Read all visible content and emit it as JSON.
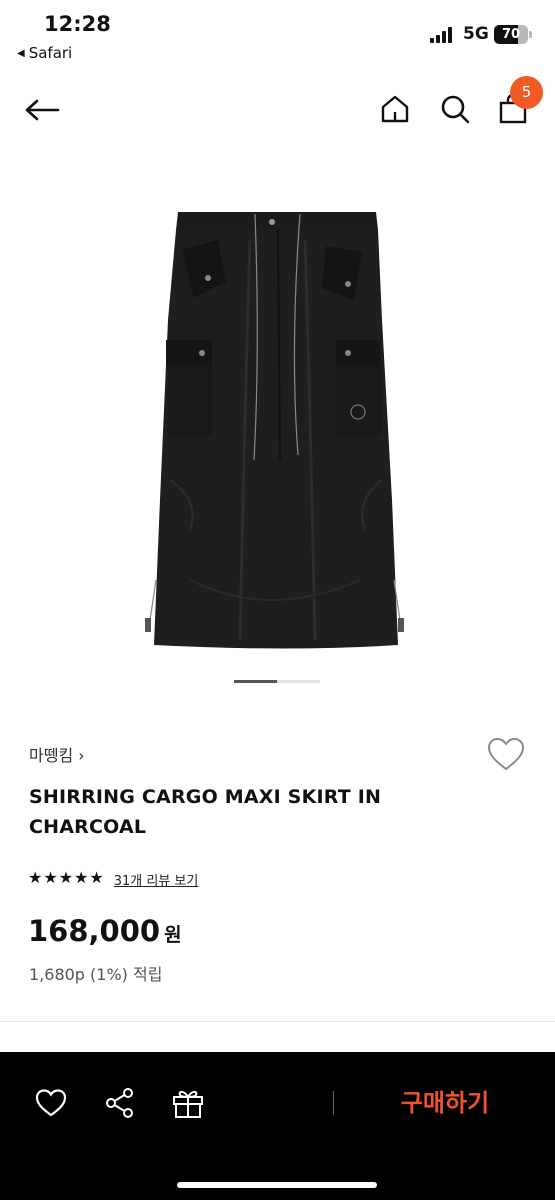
{
  "status_bar": {
    "time": "12:28",
    "back_app": "Safari",
    "network": "5G",
    "battery": "70",
    "battery_level": 0.7
  },
  "header": {
    "icons": [
      "back-arrow-icon",
      "home-icon",
      "search-icon",
      "shopping-bag-icon"
    ],
    "cart_count": "5"
  },
  "product": {
    "image_alt": "black cargo maxi skirt",
    "carousel": {
      "active_index": 1,
      "total": 2
    },
    "brand": "마뗑킴",
    "brand_chevron": "›",
    "title": "SHIRRING CARGO MAXI SKIRT IN CHARCOAL",
    "rating": 5,
    "review_link": "31개 리뷰 보기",
    "price": "168,000",
    "price_unit": "원",
    "points": "1,680p (1%) 적립"
  },
  "bottom_bar": {
    "icons": [
      "heart-icon",
      "share-icon",
      "gift-icon"
    ],
    "buy_label": "구매하기"
  },
  "colors": {
    "accent": "#f0532a",
    "badge": "#f05a24",
    "bottom_bar_bg": "#000000"
  }
}
